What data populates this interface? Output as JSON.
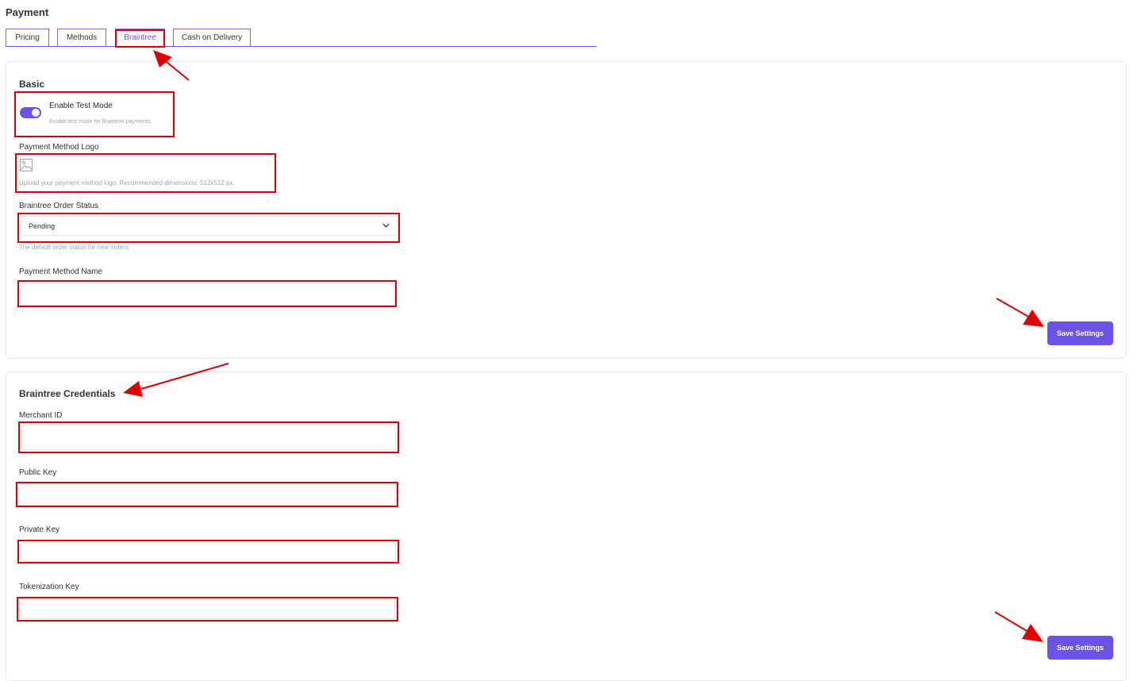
{
  "page": {
    "title": "Payment"
  },
  "tabs": [
    {
      "label": "Pricing",
      "active": false
    },
    {
      "label": "Methods",
      "active": false
    },
    {
      "label": "Braintree",
      "active": true
    },
    {
      "label": "Cash on Delivery",
      "active": false
    }
  ],
  "basic": {
    "title": "Basic",
    "test_mode": {
      "label": "Enable Test Mode",
      "hint": "Enable test mode for Braintree payments.",
      "enabled": true
    },
    "logo": {
      "label": "Payment Method Logo",
      "hint": "Upload your payment method logo. Recommended dimensions: 512x512 px.",
      "icon": "image-placeholder-icon"
    },
    "order_status": {
      "label": "Braintree Order Status",
      "value": "Pending",
      "hint": "The default order status for new orders.",
      "icon": "chevron-down-icon"
    },
    "method_name": {
      "label": "Payment Method Name",
      "value": ""
    },
    "save_label": "Save Settings"
  },
  "credentials": {
    "title": "Braintree Credentials",
    "merchant_id": {
      "label": "Merchant ID",
      "value": ""
    },
    "public_key": {
      "label": "Public Key",
      "value": ""
    },
    "private_key": {
      "label": "Private Key",
      "value": ""
    },
    "tokenization_key": {
      "label": "Tokenization Key",
      "value": ""
    },
    "save_label": "Save Settings"
  },
  "colors": {
    "accent": "#6d52e8",
    "annotation": "#e00000",
    "hint_text": "#9ca3af",
    "border": "#e5e7eb"
  }
}
